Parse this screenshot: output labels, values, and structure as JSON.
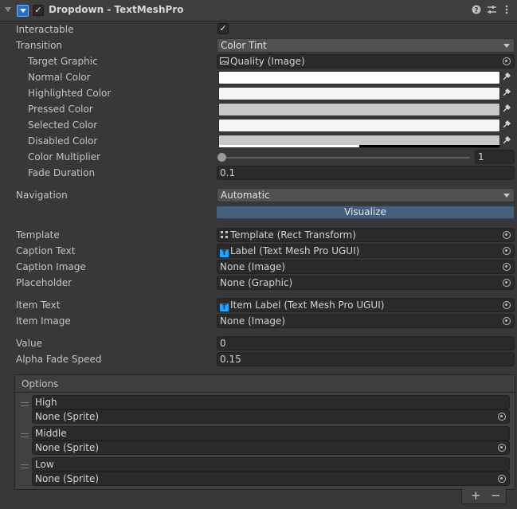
{
  "header": {
    "title": "Dropdown - TextMeshPro",
    "enabled_check": "✓",
    "icons": [
      "help-icon",
      "preset-icon",
      "kebab-menu-icon"
    ]
  },
  "fields": {
    "interactable": {
      "label": "Interactable",
      "value": "✓"
    },
    "transition": {
      "label": "Transition",
      "value": "Color Tint"
    },
    "target_graphic": {
      "label": "Target Graphic",
      "value": "Quality (Image)"
    },
    "normal_color": {
      "label": "Normal Color",
      "color": "#ffffff"
    },
    "highlighted_color": {
      "label": "Highlighted Color",
      "color": "#f5f5f5"
    },
    "pressed_color": {
      "label": "Pressed Color",
      "color": "#c8c8c8"
    },
    "selected_color": {
      "label": "Selected Color",
      "color": "#f5f5f5"
    },
    "disabled_color": {
      "label": "Disabled Color",
      "color": "#c8c8c8"
    },
    "color_multiplier": {
      "label": "Color Multiplier",
      "value": "1"
    },
    "fade_duration": {
      "label": "Fade Duration",
      "value": "0.1"
    },
    "navigation": {
      "label": "Navigation",
      "value": "Automatic"
    },
    "visualize": "Visualize",
    "template": {
      "label": "Template",
      "value": "Template (Rect Transform)"
    },
    "caption_text": {
      "label": "Caption Text",
      "value": "Label (Text Mesh Pro UGUI)"
    },
    "caption_image": {
      "label": "Caption Image",
      "value": "None (Image)"
    },
    "placeholder": {
      "label": "Placeholder",
      "value": "None (Graphic)"
    },
    "item_text": {
      "label": "Item Text",
      "value": "Item Label (Text Mesh Pro UGUI)"
    },
    "item_image": {
      "label": "Item Image",
      "value": "None (Image)"
    },
    "value": {
      "label": "Value",
      "value": "0"
    },
    "alpha_fade_speed": {
      "label": "Alpha Fade Speed",
      "value": "0.15"
    }
  },
  "options": {
    "title": "Options",
    "items": [
      {
        "text": "High",
        "sprite": "None (Sprite)"
      },
      {
        "text": "Middle",
        "sprite": "None (Sprite)"
      },
      {
        "text": "Low",
        "sprite": "None (Sprite)"
      }
    ],
    "add_label": "+",
    "remove_label": "−"
  }
}
